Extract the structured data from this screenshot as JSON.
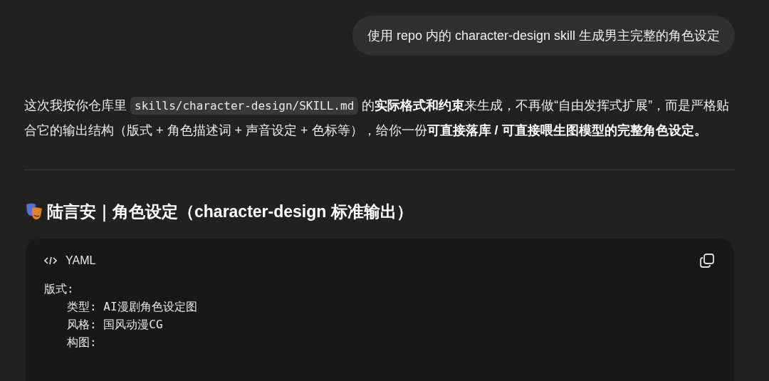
{
  "user_message": {
    "text": "使用 repo 内的 character-design skill 生成男主完整的角色设定"
  },
  "reply": {
    "paragraph": [
      {
        "kind": "text",
        "text": "这次我按你仓库里 "
      },
      {
        "kind": "code",
        "text": "skills/character-design/SKILL.md"
      },
      {
        "kind": "text",
        "text": " 的**实际格式和约束**来生成，不再做“自由发挥式扩展”，而是严格贴合它的输出结构（版式 + 角色描述词 + 声音设定 + 色标等），给你一份**可直接落库 / 可直接喂生图模型的完整角色设定。**"
      }
    ],
    "heading": "陆言安｜角色设定（character-design 标准输出）",
    "code_block": {
      "language": "YAML",
      "lines": [
        {
          "text": "版式:",
          "children": [
            {
              "text": "类型: AI漫剧角色设定图"
            },
            {
              "text": "风格: 国风动漫CG"
            },
            {
              "text": "构图:"
            }
          ]
        }
      ]
    }
  }
}
